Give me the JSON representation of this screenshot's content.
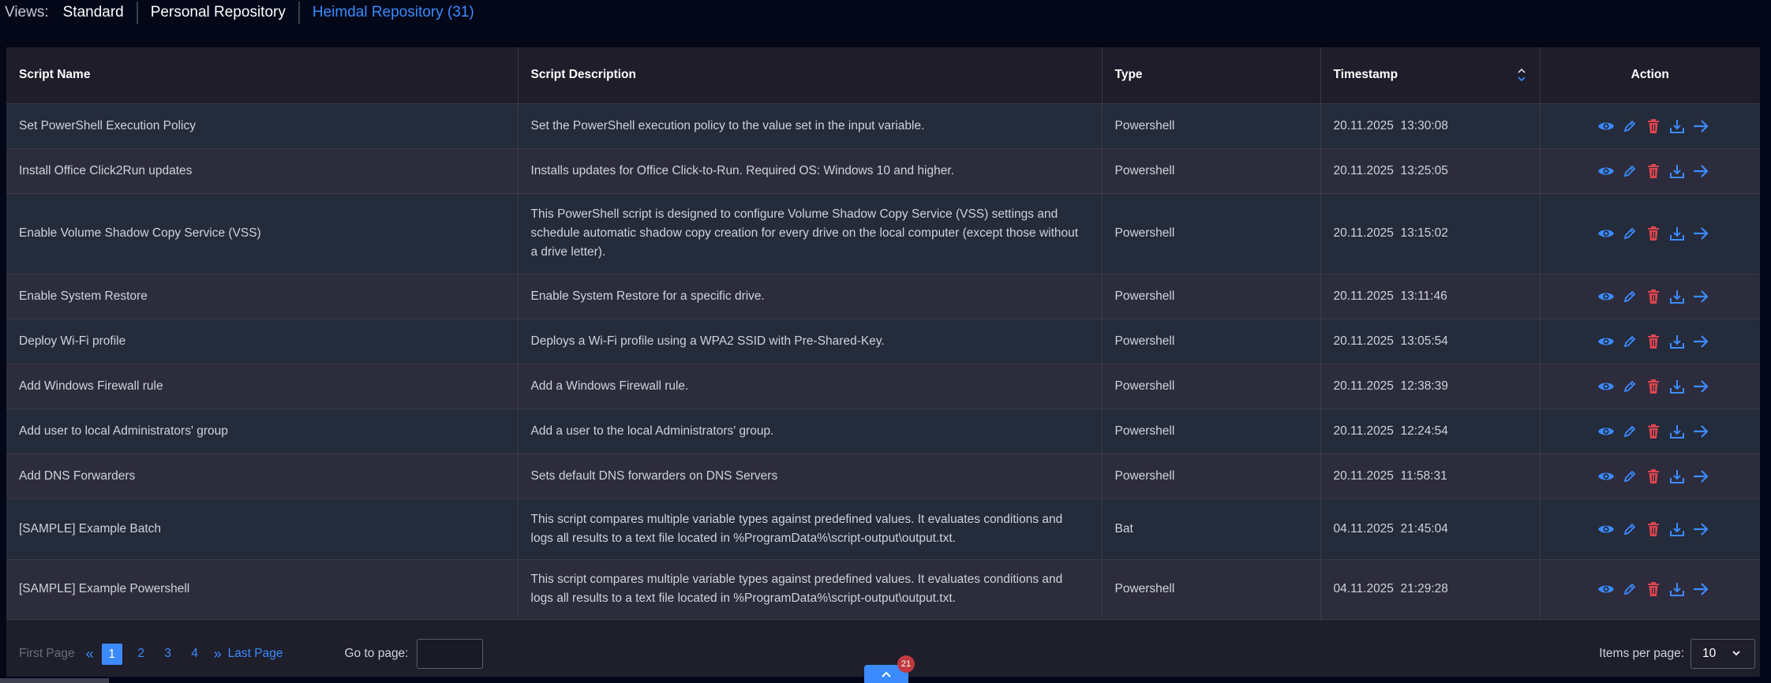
{
  "views": {
    "label": "Views:",
    "options": [
      {
        "label": "Standard"
      },
      {
        "label": "Personal Repository"
      },
      {
        "label": "Heimdal Repository (31)"
      }
    ]
  },
  "table": {
    "headers": [
      "Script Name",
      "Script Description",
      "Type",
      "Timestamp",
      "Action"
    ],
    "rows": [
      {
        "name": "Set PowerShell Execution Policy",
        "description": "Set the PowerShell execution policy to the value set in the input variable.",
        "type": "Powershell",
        "timestamp": "20.11.2025  13:30:08"
      },
      {
        "name": "Install Office Click2Run updates",
        "description": "Installs updates for Office Click-to-Run. Required OS: Windows 10 and higher.",
        "type": "Powershell",
        "timestamp": "20.11.2025  13:25:05"
      },
      {
        "name": "Enable Volume Shadow Copy Service (VSS)",
        "description": "This PowerShell script is designed to configure Volume Shadow Copy Service (VSS) settings and schedule automatic shadow copy creation for every drive on the local computer (except those without a drive letter).",
        "type": "Powershell",
        "timestamp": "20.11.2025  13:15:02"
      },
      {
        "name": "Enable System Restore",
        "description": "Enable System Restore for a specific drive.",
        "type": "Powershell",
        "timestamp": "20.11.2025  13:11:46"
      },
      {
        "name": "Deploy Wi-Fi profile",
        "description": "Deploys a Wi-Fi profile using a WPA2 SSID with Pre-Shared-Key.",
        "type": "Powershell",
        "timestamp": "20.11.2025  13:05:54"
      },
      {
        "name": "Add Windows Firewall rule",
        "description": "Add a Windows Firewall rule.",
        "type": "Powershell",
        "timestamp": "20.11.2025  12:38:39"
      },
      {
        "name": "Add user to local Administrators' group",
        "description": "Add a user to the local Administrators' group.",
        "type": "Powershell",
        "timestamp": "20.11.2025  12:24:54"
      },
      {
        "name": "Add DNS Forwarders",
        "description": "Sets default DNS forwarders on DNS Servers",
        "type": "Powershell",
        "timestamp": "20.11.2025  11:58:31"
      },
      {
        "name": "[SAMPLE] Example Batch",
        "description": "This script compares multiple variable types against predefined values. It evaluates conditions and logs all results to a text file located in %ProgramData%\\script-output\\output.txt.",
        "type": "Bat",
        "timestamp": "04.11.2025  21:45:04"
      },
      {
        "name": "[SAMPLE] Example Powershell",
        "description": "This script compares multiple variable types against predefined values. It evaluates conditions and logs all results to a text file located in %ProgramData%\\script-output\\output.txt.",
        "type": "Powershell",
        "timestamp": "04.11.2025  21:29:28"
      }
    ],
    "action_icons": [
      "eye-icon",
      "pencil-icon",
      "trash-icon",
      "download-icon",
      "arrow-right-icon"
    ]
  },
  "pagination": {
    "first_label": "First Page",
    "pages": [
      "1",
      "2",
      "3",
      "4"
    ],
    "current_page": "1",
    "last_label": "Last Page",
    "goto_label": "Go to page:",
    "goto_value": "",
    "items_per_page_label": "Items per page:",
    "items_per_page_value": "10"
  },
  "notification_count": "21",
  "colors": {
    "accent": "#3b8bff",
    "danger": "#e0454f",
    "background": "#030718"
  }
}
